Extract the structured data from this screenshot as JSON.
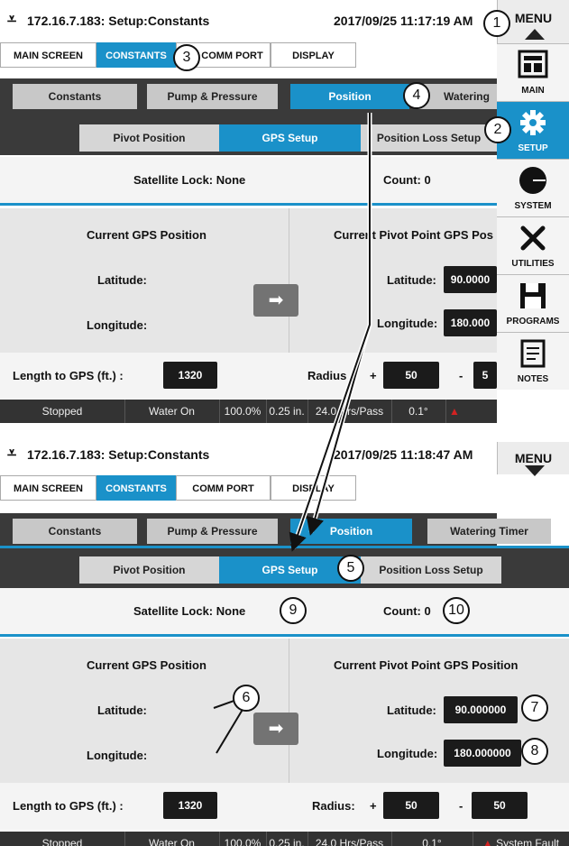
{
  "screen1": {
    "title": "172.16.7.183: Setup:Constants",
    "datetime": "2017/09/25 11:17:19 AM",
    "menu_label": "MENU",
    "top_tabs": [
      "MAIN SCREEN",
      "CONSTANTS",
      "COMM PORT",
      "DISPLAY"
    ],
    "subtabs": [
      "Constants",
      "Pump & Pressure",
      "Position",
      "Watering"
    ],
    "section_tabs": [
      "Pivot Position",
      "GPS Setup",
      "Position Loss Setup"
    ],
    "satellite_lock": "Satellite Lock: None",
    "count": "Count: 0",
    "current_gps_title": "Current GPS Position",
    "pivot_gps_title": "Current Pivot Point GPS Pos",
    "latitude_label": "Latitude:",
    "longitude_label": "Longitude:",
    "pivot_latitude": "90.0000",
    "pivot_longitude": "180.000",
    "arrow": "➡",
    "length_label": "Length to GPS (ft.) :",
    "length_value": "1320",
    "radius_label": "Radius",
    "radius_plus": "+",
    "radius_minus": "-",
    "radius_plus_value": "50",
    "radius_minus_value": "5",
    "status": [
      "Stopped",
      "Water On",
      "100.0%",
      "0.25 in.",
      "24.0 Hrs/Pass",
      "0.1°",
      "System Fault"
    ],
    "sidebar": [
      "MAIN",
      "SETUP",
      "SYSTEM",
      "UTILITIES",
      "PROGRAMS",
      "NOTES"
    ]
  },
  "screen2": {
    "title": "172.16.7.183: Setup:Constants",
    "datetime": "2017/09/25 11:18:47 AM",
    "menu_label": "MENU",
    "top_tabs": [
      "MAIN SCREEN",
      "CONSTANTS",
      "COMM PORT",
      "DISPLAY"
    ],
    "subtabs": [
      "Constants",
      "Pump & Pressure",
      "Position",
      "Watering Timer"
    ],
    "section_tabs": [
      "Pivot Position",
      "GPS Setup",
      "Position Loss Setup"
    ],
    "satellite_lock": "Satellite Lock: None",
    "count": "Count: 0",
    "current_gps_title": "Current GPS Position",
    "pivot_gps_title": "Current Pivot Point GPS Position",
    "latitude_label": "Latitude:",
    "longitude_label": "Longitude:",
    "pivot_latitude": "90.000000",
    "pivot_longitude": "180.000000",
    "arrow": "➡",
    "length_label": "Length to GPS (ft.) :",
    "length_value": "1320",
    "radius_label": "Radius:",
    "radius_plus": "+",
    "radius_minus": "-",
    "radius_plus_value": "50",
    "radius_minus_value": "50",
    "status": [
      "Stopped",
      "Water On",
      "100.0%",
      "0.25 in.",
      "24.0 Hrs/Pass",
      "0.1°",
      "System Fault"
    ]
  },
  "callouts": [
    "1",
    "2",
    "3",
    "4",
    "5",
    "6",
    "7",
    "8",
    "9",
    "10"
  ],
  "colors": {
    "accent": "#1a91c9",
    "dark_band": "#3a3a3a",
    "status_bar": "#333333",
    "fault": "#d22222"
  }
}
